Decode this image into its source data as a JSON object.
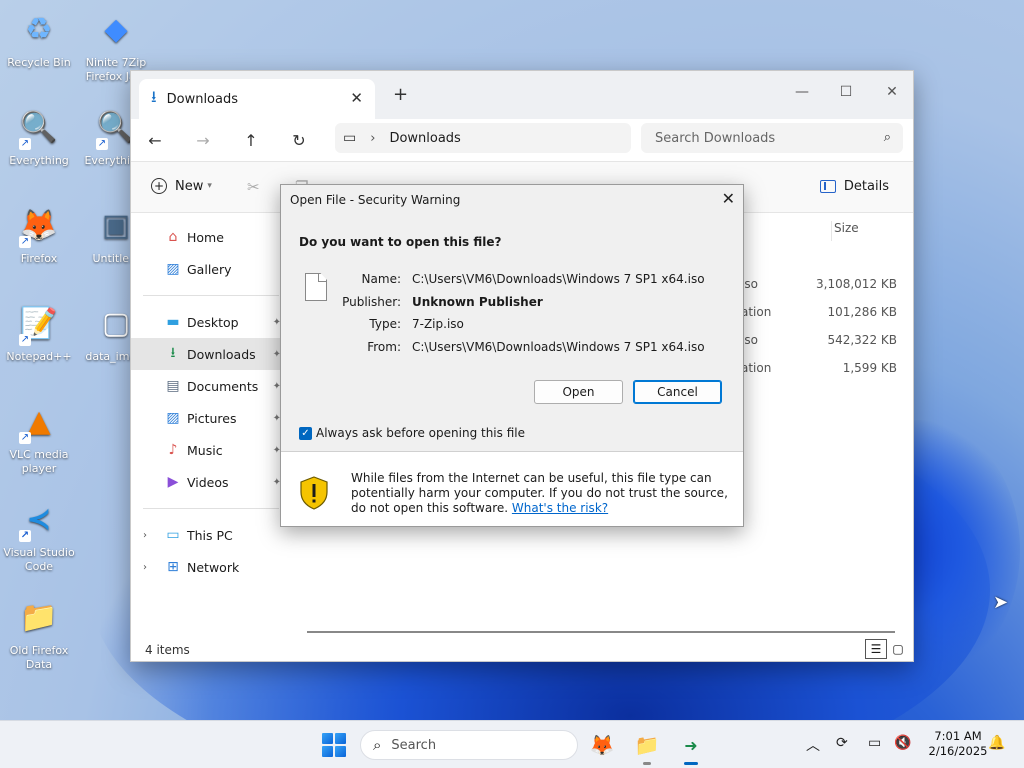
{
  "desktop": {
    "icons": [
      {
        "label": "Recycle Bin",
        "glyph": "♻"
      },
      {
        "label": "Ninite 7Zip Firefox Ja...",
        "glyph": "◆"
      },
      {
        "label": "Everything",
        "glyph": "🔍"
      },
      {
        "label": "Everythin...",
        "glyph": "🔍"
      },
      {
        "label": "Firefox",
        "glyph": "🦊"
      },
      {
        "label": "Untitle...",
        "glyph": "▣"
      },
      {
        "label": "Notepad++",
        "glyph": "📝"
      },
      {
        "label": "data_ima...",
        "glyph": "▢"
      },
      {
        "label": "VLC media player",
        "glyph": "▲"
      },
      {
        "label": "Visual Studio Code",
        "glyph": "≺"
      },
      {
        "label": "Old Firefox Data",
        "glyph": "📁"
      }
    ]
  },
  "explorer": {
    "tab_title": "Downloads",
    "new_tab": "+",
    "address": "Downloads",
    "search_placeholder": "Search Downloads",
    "cmd_new": "New",
    "cmd_details": "Details",
    "col_size": "Size",
    "sidebar": {
      "home": "Home",
      "gallery": "Gallery",
      "desktop": "Desktop",
      "downloads": "Downloads",
      "documents": "Documents",
      "pictures": "Pictures",
      "music": "Music",
      "videos": "Videos",
      "this_pc": "This PC",
      "network": "Network"
    },
    "rows": [
      {
        "type": "iso",
        "size": "3,108,012 KB"
      },
      {
        "type": "ation",
        "size": "101,286 KB"
      },
      {
        "type": "iso",
        "size": "542,322 KB"
      },
      {
        "type": "ation",
        "size": "1,599 KB"
      }
    ],
    "status": "4 items"
  },
  "dialog": {
    "title": "Open File - Security Warning",
    "question": "Do you want to open this file?",
    "name_label": "Name:",
    "name_value": "C:\\Users\\VM6\\Downloads\\Windows 7 SP1 x64.iso",
    "publisher_label": "Publisher:",
    "publisher_value": "Unknown Publisher",
    "type_label": "Type:",
    "type_value": "7-Zip.iso",
    "from_label": "From:",
    "from_value": "C:\\Users\\VM6\\Downloads\\Windows 7 SP1 x64.iso",
    "open_label": "Open",
    "cancel_label": "Cancel",
    "checkbox_label": "Always ask before opening this file",
    "warning_text": "While files from the Internet can be useful, this file type can potentially harm your computer. If you do not trust the source, do not open this software.",
    "risk_link": "What's the risk?"
  },
  "taskbar": {
    "search_placeholder": "Search",
    "time": "7:01 AM",
    "date": "2/16/2025"
  },
  "colors": {
    "accent": "#0067c0",
    "link": "#0066cc",
    "shield_yellow": "#f5c400"
  }
}
